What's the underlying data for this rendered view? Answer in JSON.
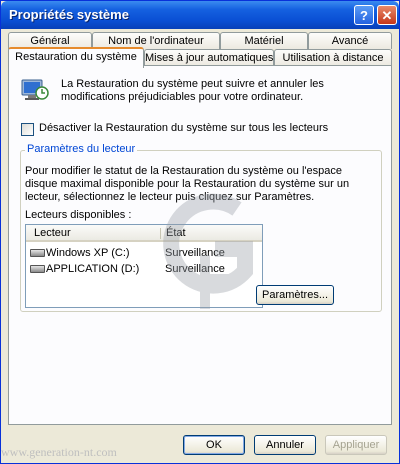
{
  "window": {
    "title": "Propriétés système",
    "help_glyph": "?",
    "close_glyph": "✕"
  },
  "tabs": {
    "row_back": [
      "Général",
      "Nom de l'ordinateur",
      "Matériel",
      "Avancé"
    ],
    "row_front": [
      "Restauration du système",
      "Mises à jour automatiques",
      "Utilisation à distance"
    ],
    "active": "Restauration du système"
  },
  "restore": {
    "description": "La Restauration du système peut suivre et annuler les modifications préjudiciables pour votre ordinateur.",
    "disable_checkbox_label": "Désactiver la Restauration du système sur tous les lecteurs",
    "disable_checked": false,
    "group_title": "Paramètres du lecteur",
    "group_description": "Pour modifier le statut de la Restauration du système ou l'espace disque maximal disponible pour la Restauration du système sur un lecteur, sélectionnez le lecteur puis cliquez sur Paramètres.",
    "available_label": "Lecteurs disponibles :",
    "columns": [
      "Lecteur",
      "État"
    ],
    "drives": [
      {
        "name": "Windows XP (C:)",
        "state": "Surveillance"
      },
      {
        "name": "APPLICATION (D:)",
        "state": "Surveillance"
      }
    ],
    "settings_button": "Paramètres..."
  },
  "buttons": {
    "ok": "OK",
    "cancel": "Annuler",
    "apply": "Appliquer"
  },
  "watermark": {
    "text": "www.generation-nt.com"
  },
  "colors": {
    "titlebar": "#0a4fd4",
    "dialog_bg": "#ece9d8",
    "group_title": "#0046d5",
    "active_tab_accent": "#e68b2c"
  }
}
